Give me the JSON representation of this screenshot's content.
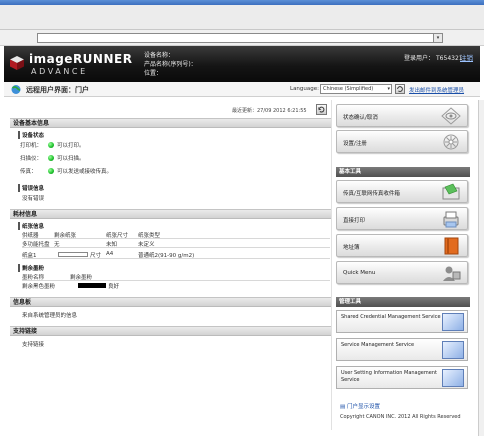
{
  "browser": {
    "address_dropdown": "▾"
  },
  "header": {
    "logo_main": "imageRUNNER",
    "logo_sub": "ADVANCE",
    "device_name_label": "设备名称：",
    "product_name_label": "产品名称(序列号)：",
    "location_label": "位置：",
    "login_user_label": "登录用户：",
    "login_user_value": "T654321",
    "logout": "注销"
  },
  "subheader": {
    "title": "远程用户界面：门户",
    "language_label": "Language:",
    "language_value": "Chinese (Simplified)",
    "mail_link": "发出邮件到系统管理员"
  },
  "main": {
    "last_updated": "最近更新：27/09 2012 6:21:55",
    "device_basic_info": "设备基本信息",
    "device_status": "设备状态",
    "status_rows": [
      {
        "label": "打印机：",
        "value": "可以打印。"
      },
      {
        "label": "扫描仪：",
        "value": "可以扫描。"
      },
      {
        "label": "传真：",
        "value": "可以发送或接收传真。"
      }
    ],
    "error_info": "错误信息",
    "no_error": "没有错误",
    "consumables_info": "耗材信息",
    "paper_info": "纸张信息",
    "paper_headers": [
      "供纸器",
      "剩余纸张",
      "纸张尺寸",
      "纸张类型"
    ],
    "paper_row": [
      "多功能托盘",
      "无",
      "未知",
      "未定义"
    ],
    "paper_row2": {
      "source": "纸盒1",
      "size_label": "尺寸",
      "size": "A4",
      "type": "普通纸2(91-90 g/m2)"
    },
    "toner_info": "剩余墨粉",
    "toner_headers": [
      "墨粉名称",
      "剩余墨粉"
    ],
    "toner_row": {
      "name": "剩余黑色墨粉",
      "status": "良好"
    },
    "message_board": "信息板",
    "message_text": "来自系统管理员的信息",
    "support_links": "支持链接",
    "support_text": "支持链接"
  },
  "side": {
    "status_monitor": "状态确认/取消",
    "settings": "设置/注册",
    "basic_tools": "基本工具",
    "fax_inbox": "传真/互联网传真收件箱",
    "direct_print": "直接打印",
    "address_book": "地址簿",
    "quick_menu": "Quick Menu",
    "management_tools": "管理工具",
    "shared_cred": "Shared Credential Management Service",
    "service_mgmt": "Service Management Service",
    "user_setting": "User Setting Information Management Service",
    "portal_settings": "门户显示设置",
    "copyright": "Copyright CANON INC. 2012 All Rights Reserved"
  },
  "colors": {
    "header_bg": "#151515",
    "status_green": "#1bbf2a",
    "link_blue": "#1a4fa8"
  }
}
